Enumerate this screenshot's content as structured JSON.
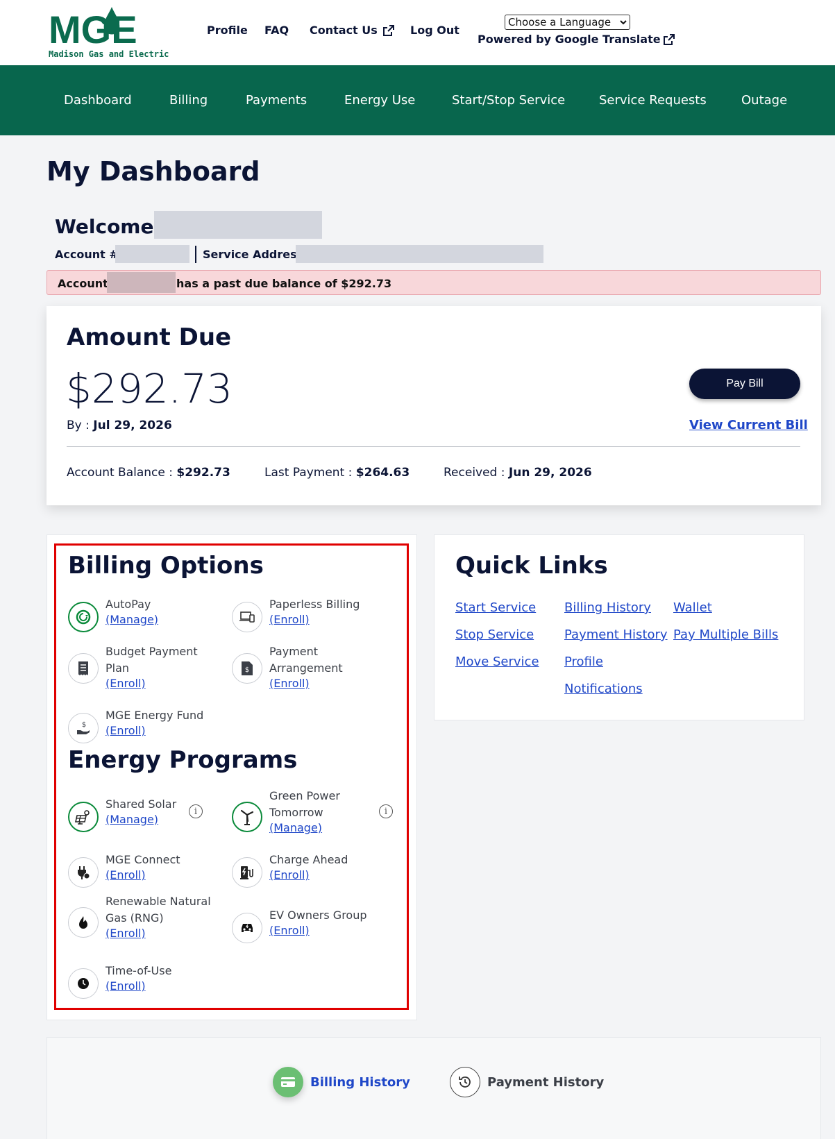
{
  "header": {
    "logo_text": "MGE",
    "logo_subtitle": "Madison Gas and Electric",
    "links": {
      "profile": "Profile",
      "faq": "FAQ",
      "contact": "Contact Us",
      "logout": "Log Out"
    },
    "language_select": "Choose a Language",
    "powered_by": "Powered by Google Translate"
  },
  "nav": {
    "dashboard": "Dashboard",
    "billing": "Billing",
    "payments": "Payments",
    "energy_use": "Energy Use",
    "start_stop": "Start/Stop Service",
    "service_requests": "Service Requests",
    "outage": "Outage"
  },
  "page": {
    "title": "My Dashboard",
    "welcome": "Welcome,",
    "account_label": "Account #",
    "service_address_label": "Service Address",
    "alert_prefix": "Account",
    "alert_suffix": "has a past due balance of $292.73"
  },
  "amount": {
    "title": "Amount Due",
    "value": "$292.73",
    "by_label": "By :",
    "by_date": "Jul 29, 2026",
    "pay_button": "Pay Bill",
    "view_bill": "View Current Bill",
    "balance_label": "Account Balance :",
    "balance_value": "$292.73",
    "last_payment_label": "Last Payment :",
    "last_payment_value": "$264.63",
    "received_label": "Received :",
    "received_value": "Jun 29, 2026"
  },
  "billing_options": {
    "title": "Billing Options",
    "items": [
      {
        "label": "AutoPay",
        "link": "(Manage)"
      },
      {
        "label": "Paperless Billing",
        "link": "(Enroll)"
      },
      {
        "label": "Budget Payment Plan",
        "link": "(Enroll)"
      },
      {
        "label": "Payment Arrangement",
        "link": "(Enroll)"
      },
      {
        "label": "MGE Energy Fund",
        "link": "(Enroll)"
      }
    ]
  },
  "energy_programs": {
    "title": "Energy Programs",
    "items": [
      {
        "label": "Shared Solar",
        "link": "(Manage)"
      },
      {
        "label": "Green Power Tomorrow",
        "link": "(Manage)"
      },
      {
        "label": "MGE Connect",
        "link": "(Enroll)"
      },
      {
        "label": "Charge Ahead",
        "link": "(Enroll)"
      },
      {
        "label": "Renewable Natural Gas (RNG)",
        "link": "(Enroll)"
      },
      {
        "label": "EV Owners Group",
        "link": "(Enroll)"
      },
      {
        "label": "Time-of-Use",
        "link": "(Enroll)"
      }
    ]
  },
  "quick_links": {
    "title": "Quick Links",
    "start_service": "Start Service",
    "stop_service": "Stop Service",
    "move_service": "Move Service",
    "billing_history": "Billing History",
    "payment_history": "Payment History",
    "profile": "Profile",
    "notifications": "Notifications",
    "wallet": "Wallet",
    "pay_multiple": "Pay Multiple Bills"
  },
  "history_tabs": {
    "billing": "Billing History",
    "payment": "Payment History"
  },
  "colors": {
    "brand_green": "#08664d",
    "navy": "#0b1435",
    "link_blue": "#1f47c8",
    "alert_bg": "#f8d7da",
    "highlight_red": "#e00000"
  }
}
